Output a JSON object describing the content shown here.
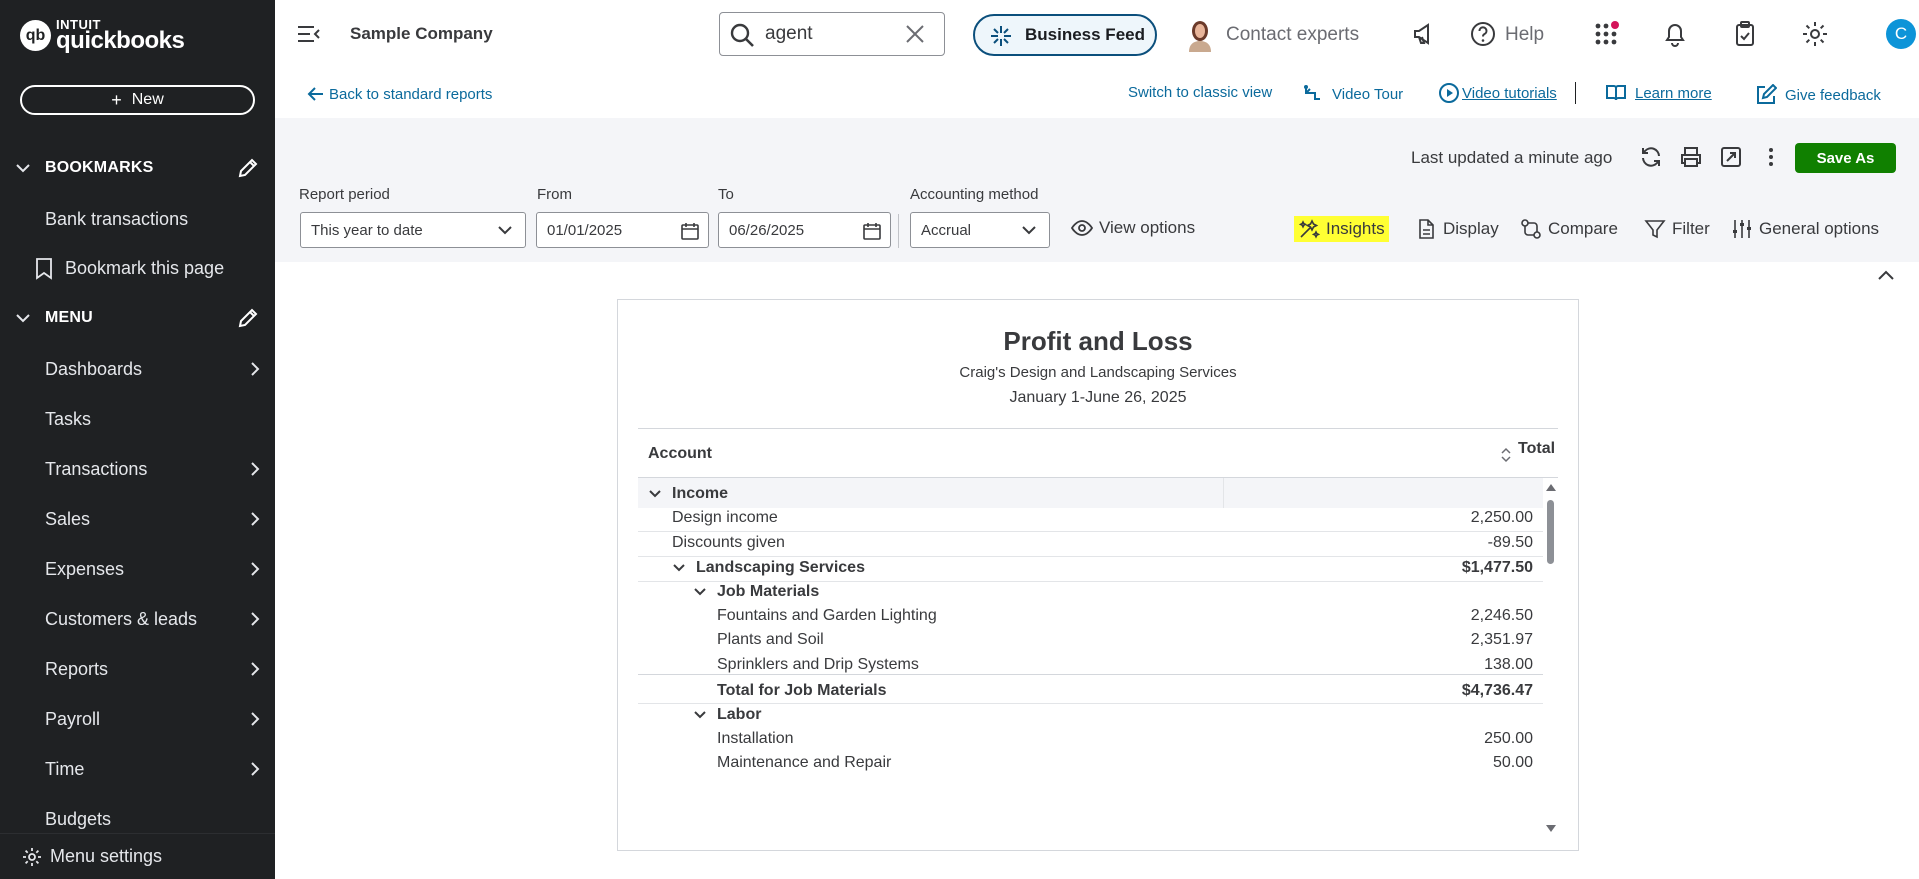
{
  "brand": {
    "intuit": "INTUIT",
    "product": "quickbooks"
  },
  "sidebar": {
    "new_label": "New",
    "bookmarks_label": "BOOKMARKS",
    "bookmark_items": [
      "Bank transactions",
      "Bookmark this page"
    ],
    "menu_label": "MENU",
    "menu_items": [
      "Dashboards",
      "Tasks",
      "Transactions",
      "Sales",
      "Expenses",
      "Customers & leads",
      "Reports",
      "Payroll",
      "Time",
      "Budgets"
    ],
    "menu_settings": "Menu settings"
  },
  "topbar": {
    "company": "Sample Company",
    "search_value": "agent",
    "business_feed": "Business Feed",
    "contact_experts": "Contact experts",
    "help": "Help",
    "user_initial": "C"
  },
  "links": {
    "back": "Back to standard reports",
    "classic": "Switch to classic view",
    "video_tour": "Video Tour",
    "video_tutorials": "Video tutorials",
    "learn_more": "Learn more",
    "give_feedback": "Give feedback"
  },
  "filters": {
    "last_updated": "Last updated a minute ago",
    "save_as": "Save As",
    "report_period_label": "Report period",
    "report_period_value": "This year to date",
    "from_label": "From",
    "from_value": "01/01/2025",
    "to_label": "To",
    "to_value": "06/26/2025",
    "method_label": "Accounting method",
    "method_value": "Accrual",
    "view_options": "View options",
    "insights": "Insights",
    "display": "Display",
    "compare": "Compare",
    "filter": "Filter",
    "general_options": "General options"
  },
  "report": {
    "title": "Profit and Loss",
    "company": "Craig's Design and Landscaping Services",
    "date_range": "January 1-June 26, 2025",
    "col_account": "Account",
    "col_total": "Total",
    "rows": [
      {
        "account": "Income",
        "amount": ""
      },
      {
        "account": "Design income",
        "amount": "2,250.00"
      },
      {
        "account": "Discounts given",
        "amount": "-89.50"
      },
      {
        "account": "Landscaping Services",
        "amount": "$1,477.50"
      },
      {
        "account": "Job Materials",
        "amount": ""
      },
      {
        "account": "Fountains and Garden Lighting",
        "amount": "2,246.50"
      },
      {
        "account": "Plants and Soil",
        "amount": "2,351.97"
      },
      {
        "account": "Sprinklers and Drip Systems",
        "amount": "138.00"
      },
      {
        "account": "Total for Job Materials",
        "amount": "$4,736.47"
      },
      {
        "account": "Labor",
        "amount": ""
      },
      {
        "account": "Installation",
        "amount": "250.00"
      },
      {
        "account": "Maintenance and Repair",
        "amount": "50.00"
      }
    ]
  },
  "colors": {
    "sidebar_bg": "#1f2123",
    "save_green": "#108000",
    "link_blue": "#0b6a9c",
    "highlight": "#ffff33",
    "avatar_blue": "#0d94d8"
  }
}
